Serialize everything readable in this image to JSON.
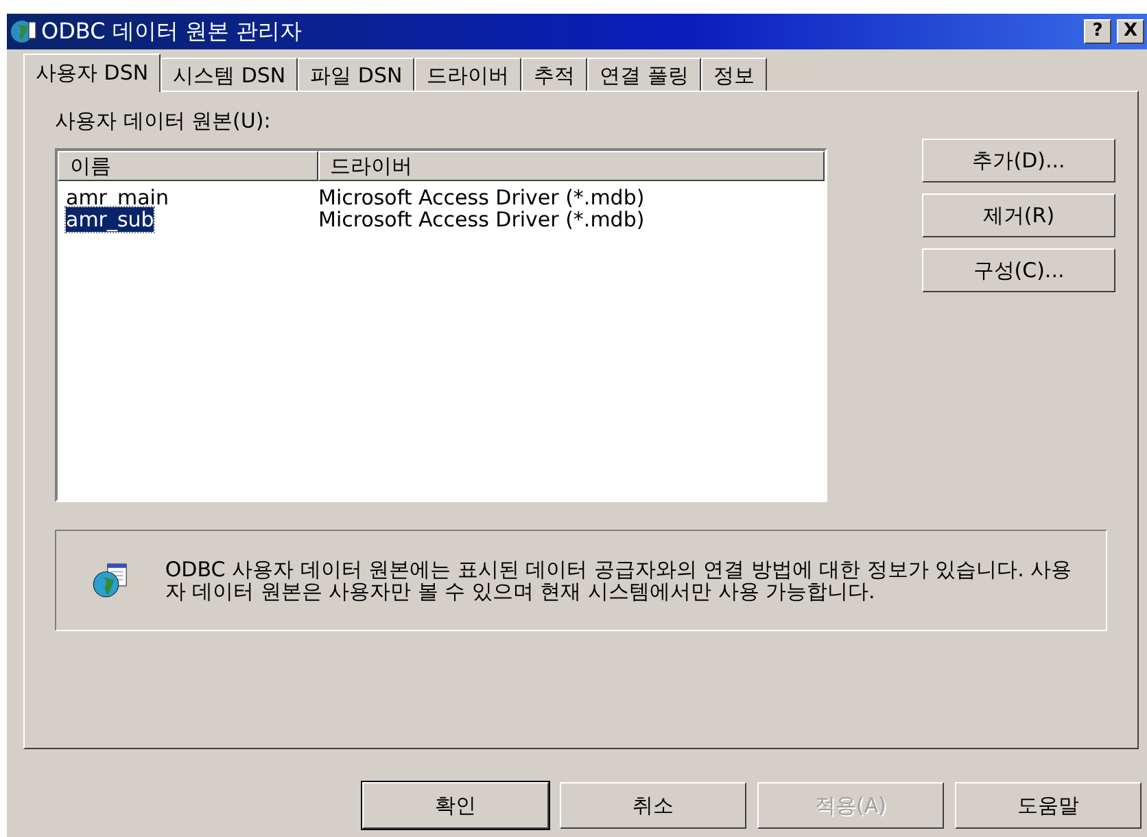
{
  "window": {
    "title": "ODBC 데이터 원본 관리자",
    "title_buttons": [
      "?",
      "X"
    ]
  },
  "tabs": [
    {
      "label": "사용자 DSN",
      "selected": true
    },
    {
      "label": "시스템 DSN",
      "selected": false
    },
    {
      "label": "파일 DSN",
      "selected": false
    },
    {
      "label": "드라이버",
      "selected": false
    },
    {
      "label": "추적",
      "selected": false
    },
    {
      "label": "연결 풀링",
      "selected": false
    },
    {
      "label": "정보",
      "selected": false
    }
  ],
  "list_label": "사용자 데이터 원본(U):",
  "table": {
    "columns": [
      "이름",
      "드라이버"
    ],
    "rows": [
      {
        "cells": [
          "amr_main",
          "Microsoft Access Driver (*.mdb)"
        ],
        "selected": false
      },
      {
        "cells": [
          "amr_sub",
          "Microsoft Access Driver (*.mdb)"
        ],
        "selected": true
      }
    ]
  },
  "side_buttons": [
    {
      "label": "추가(D)...",
      "disabled": false
    },
    {
      "label": "제거(R)",
      "disabled": false
    },
    {
      "label": "구성(C)...",
      "disabled": false
    }
  ],
  "info": "ODBC 사용자 데이터 원본에는 표시된 데이터 공급자와의 연결 방법에 대한 정보가 있습니다. 사용자 데이터 원본은 사용자만 볼 수 있으며 현재 시스템에서만 사용 가능합니다.",
  "buttons": [
    {
      "label": "확인",
      "disabled": false,
      "default": true
    },
    {
      "label": "취소",
      "disabled": false,
      "default": false
    },
    {
      "label": "적용(A)",
      "disabled": true,
      "default": false
    },
    {
      "label": "도움말",
      "disabled": false,
      "default": false
    }
  ]
}
